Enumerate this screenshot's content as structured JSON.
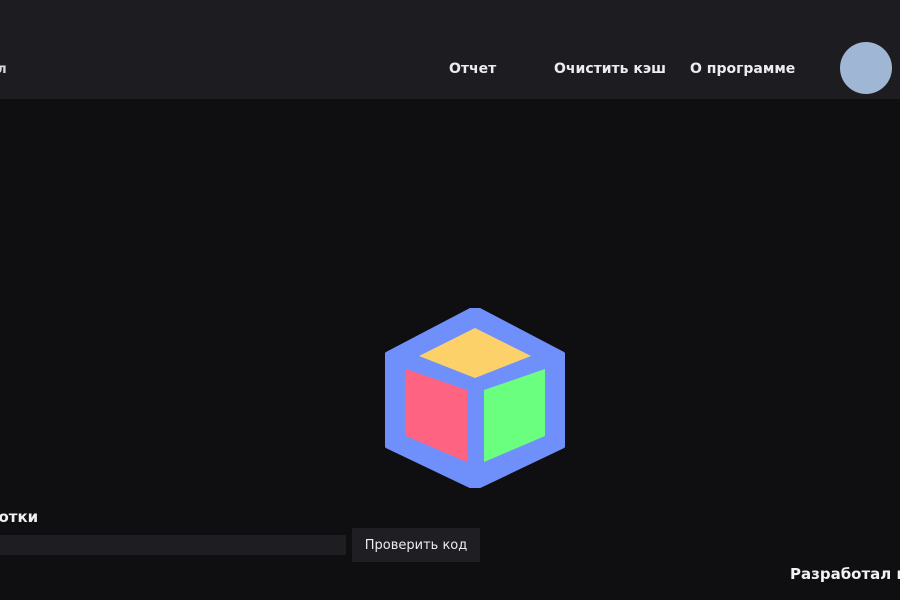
{
  "header": {
    "menu_file_label": "йл",
    "nav": {
      "report": "Отчет",
      "clear_cache": "Очистить кэш",
      "about": "О программе"
    },
    "avatar_color": "#9fb6d4"
  },
  "logo": {
    "icon": "cube-icon",
    "colors": {
      "frame": "#6f8ffa",
      "top": "#fdd16a",
      "left": "#ff6382",
      "right": "#6bff80"
    }
  },
  "main": {
    "section_title": "ботки",
    "code_input": {
      "value": "",
      "placeholder": ""
    },
    "check_button_label": "Проверить код"
  },
  "footer": {
    "credit": "Разработал п"
  }
}
